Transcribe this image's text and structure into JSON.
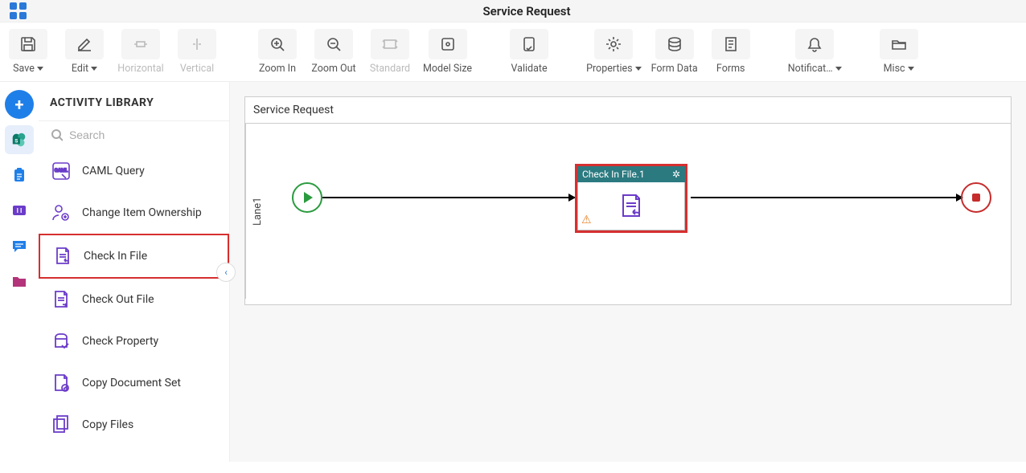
{
  "header": {
    "title": "Service Request"
  },
  "toolbar": {
    "save": "Save",
    "edit": "Edit",
    "horizontal": "Horizontal",
    "vertical": "Vertical",
    "zoomin": "Zoom In",
    "zoomout": "Zoom Out",
    "standard": "Standard",
    "modelsize": "Model Size",
    "validate": "Validate",
    "properties": "Properties",
    "formdata": "Form Data",
    "forms": "Forms",
    "notifications": "Notificat…",
    "misc": "Misc"
  },
  "sidebar": {
    "title": "ACTIVITY LIBRARY",
    "search_placeholder": "Search",
    "items": [
      {
        "label": "CAML Query"
      },
      {
        "label": "Change Item Ownership"
      },
      {
        "label": "Check In File"
      },
      {
        "label": "Check Out File"
      },
      {
        "label": "Check Property"
      },
      {
        "label": "Copy Document Set"
      },
      {
        "label": "Copy Files"
      }
    ]
  },
  "canvas": {
    "process_title": "Service Request",
    "lane_label": "Lane1",
    "activity_title": "Check In File.1"
  }
}
